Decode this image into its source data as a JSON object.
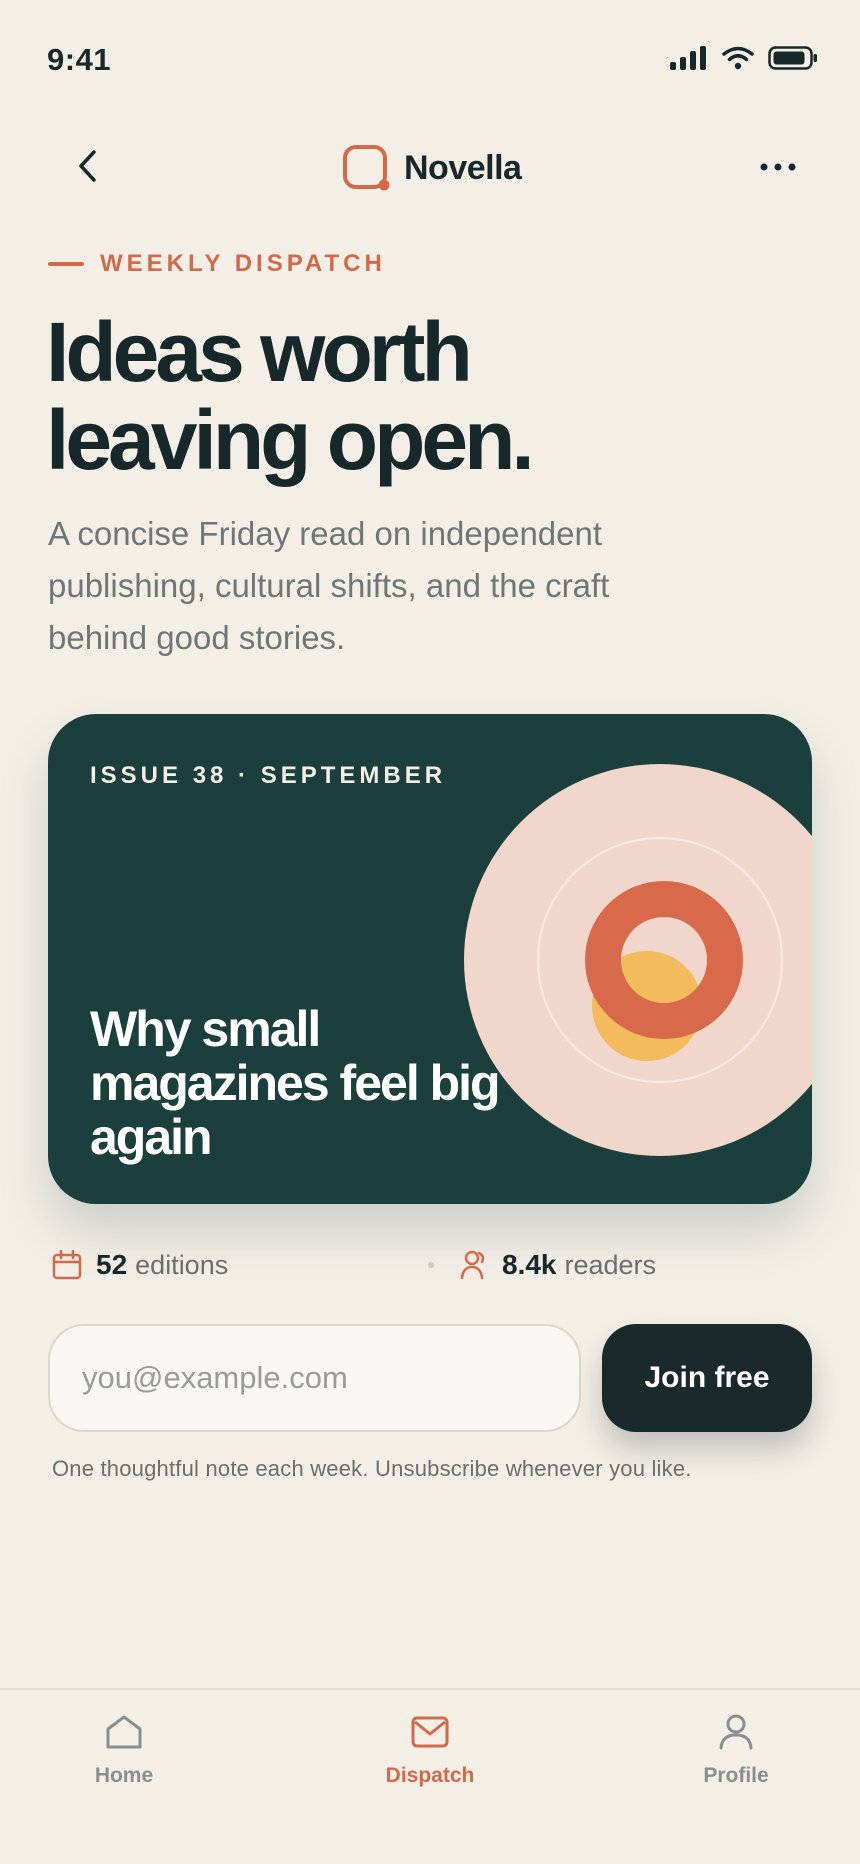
{
  "status_bar": {
    "time": "9:41",
    "icons": [
      "signal-icon",
      "wifi-icon",
      "battery-icon"
    ]
  },
  "nav": {
    "back_icon": "chevron-left-icon",
    "brand_name": "Novella",
    "logo_icon": "novella-logo-icon",
    "more_icon": "more-horizontal-icon"
  },
  "eyebrow": "WEEKLY DISPATCH",
  "headline": "Ideas worth leaving open.",
  "subtitle": "A concise Friday read on independent publishing, cultural shifts, and the craft behind good stories.",
  "hero": {
    "issue": "ISSUE 38 · SEPTEMBER",
    "title": "Why small magazines feel big again"
  },
  "stats": {
    "editions": {
      "icon": "calendar-icon",
      "number": "52",
      "label": "editions"
    },
    "readers": {
      "icon": "user-icon",
      "number": "8.4k",
      "label": "readers"
    }
  },
  "signup": {
    "email_placeholder": "you@example.com",
    "email_value": "",
    "button_label": "Join free",
    "fineprint": "One thoughtful note each week. Unsubscribe whenever you like."
  },
  "tabs": [
    {
      "label": "Home",
      "icon": "home-icon",
      "active": false
    },
    {
      "label": "Dispatch",
      "icon": "mail-icon",
      "active": true
    },
    {
      "label": "Profile",
      "icon": "user-icon",
      "active": false
    }
  ],
  "colors": {
    "background": "#f3efe7",
    "accent": "#d4694a",
    "ink": "#17282a",
    "card": "#1a3f3c",
    "art_blush": "#f1d6cb",
    "art_yellow": "#f2bb5c"
  }
}
